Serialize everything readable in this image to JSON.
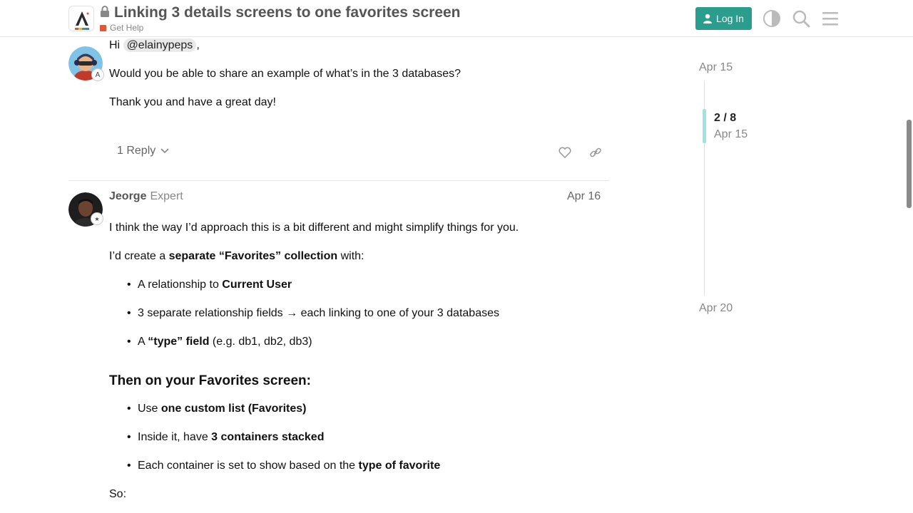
{
  "header": {
    "title": "Linking 3 details screens to one favorites screen",
    "category": "Get Help",
    "login_label": "Log In",
    "icons": [
      "lock-icon",
      "user-icon",
      "theme-toggle-icon",
      "search-icon",
      "hamburger-menu-icon"
    ],
    "colors": {
      "accent": "#2a9d8f",
      "category": "#e45735"
    }
  },
  "post1": {
    "greeting": "Hi",
    "mention": "@elainypeps",
    "comma": ",",
    "line2": "Would you be able to share an example of what’s in the 3 databases?",
    "line3": "Thank you and have a great day!",
    "reply_label": "1 Reply"
  },
  "post2": {
    "author": "Jeorge",
    "author_title": "Expert",
    "date": "Apr 16",
    "p1": "I think the way I’d approach this is a bit different and might simplify things for you.",
    "p2_a": "I’d create a ",
    "p2_b": "separate “Favorites” collection",
    "p2_c": " with:",
    "bullets1": [
      {
        "a": "A relationship to ",
        "b": "Current User",
        "c": ""
      },
      {
        "a": "3 separate relationship fields → each linking to one of your 3 databases",
        "b": "",
        "c": ""
      },
      {
        "a": "A ",
        "b": "“type” field",
        "c": " (e.g. db1, db2, db3)"
      }
    ],
    "heading": "Then on your Favorites screen:",
    "bullets2": [
      {
        "a": "Use ",
        "b": "one custom list (Favorites)",
        "c": ""
      },
      {
        "a": "Inside it, have ",
        "b": "3 containers stacked",
        "c": ""
      },
      {
        "a": "Each container is set to show based on the ",
        "b": "type of favorite",
        "c": ""
      }
    ],
    "so": "So:"
  },
  "timeline": {
    "start_date": "Apr 15",
    "position": "2 / 8",
    "position_date": "Apr 15",
    "end_date": "Apr 20"
  }
}
